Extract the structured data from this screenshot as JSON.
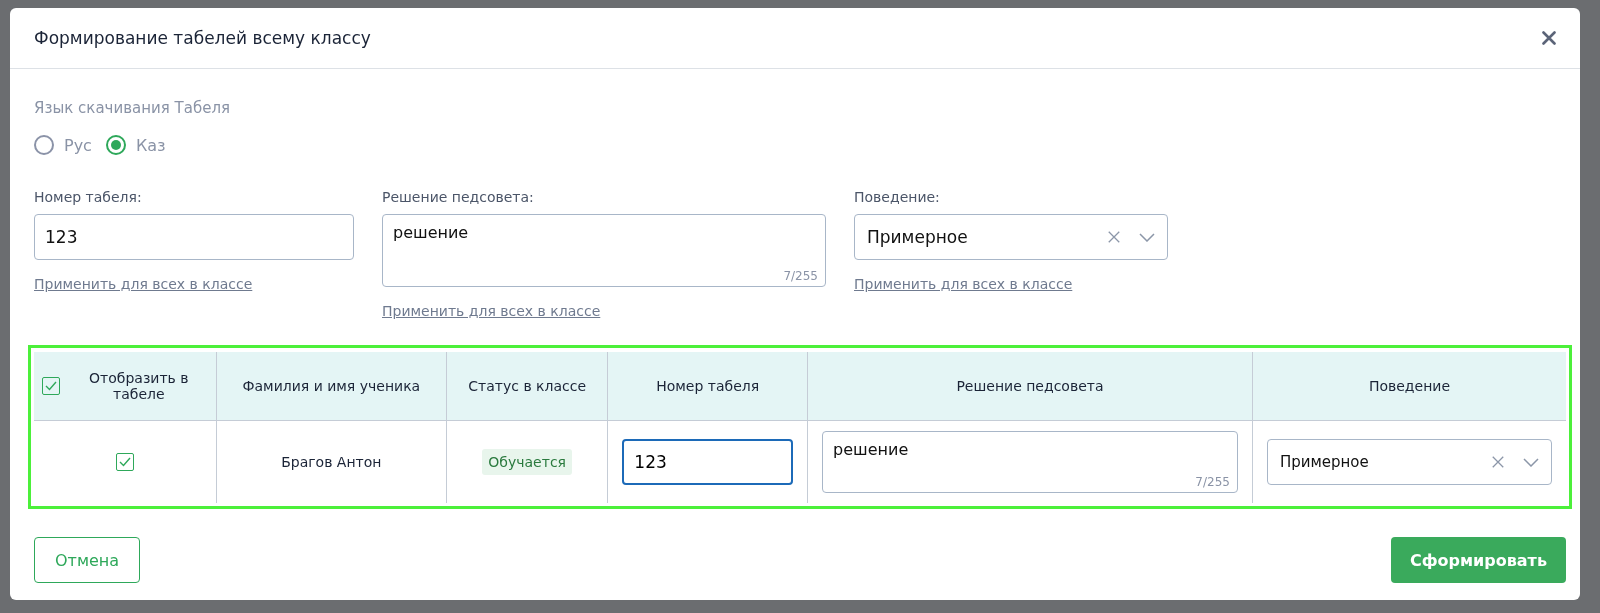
{
  "dialog": {
    "title": "Формирование табелей всему классу"
  },
  "language": {
    "label": "Язык скачивания Табеля",
    "options": [
      {
        "label": "Рус",
        "selected": false
      },
      {
        "label": "Каз",
        "selected": true
      }
    ]
  },
  "fields": [
    {
      "kind": "input",
      "label": "Номер табеля:",
      "value": "123",
      "link": "Применить для всех в классе"
    },
    {
      "kind": "textarea",
      "label": "Решение педсовета:",
      "value": "решение",
      "counter": "7/255",
      "link": "Применить для всех в классе"
    },
    {
      "kind": "select",
      "label": "Поведение:",
      "value": "Примерное",
      "link": "Применить для всех в классе"
    }
  ],
  "table": {
    "header_checkbox": {
      "checked": true
    },
    "columns": [
      "Отобразить в табеле",
      "Фамилия и имя ученика",
      "Статус в классе",
      "Номер табеля",
      "Решение педсовета",
      "Поведение"
    ],
    "rows": [
      {
        "checked": true,
        "name": "Брагов Антон",
        "status": "Обучается",
        "number": "123",
        "decision": "решение",
        "counter": "7/255",
        "behavior": "Примерное"
      }
    ]
  },
  "buttons": {
    "cancel": "Отмена",
    "submit": "Сформировать"
  }
}
